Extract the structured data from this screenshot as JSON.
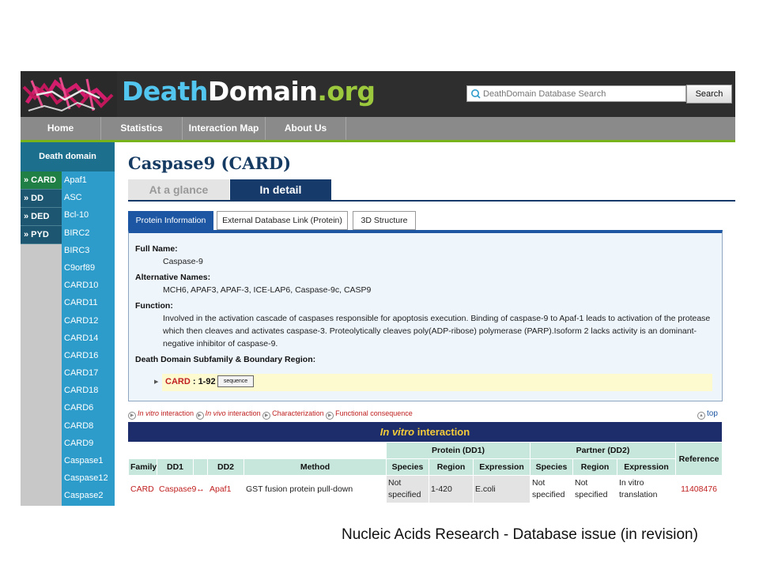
{
  "header": {
    "logo_part1": "Death",
    "logo_part2": "Domain",
    "logo_part3": ".org",
    "search_placeholder": "DeathDomain Database Search",
    "search_button": "Search"
  },
  "nav": {
    "items": [
      "Home",
      "Statistics",
      "Interaction Map",
      "About Us"
    ]
  },
  "sidebar": {
    "heading": "Death domain",
    "categories": [
      "» CARD",
      "» DD",
      "» DED",
      "» PYD"
    ],
    "active_category": "» CARD",
    "proteins": [
      "Apaf1",
      "ASC",
      "Bcl-10",
      "BIRC2",
      "BIRC3",
      "C9orf89",
      "CARD10",
      "CARD11",
      "CARD12",
      "CARD14",
      "CARD16",
      "CARD17",
      "CARD18",
      "CARD6",
      "CARD8",
      "CARD9",
      "Caspase1",
      "Caspase12",
      "Caspase2"
    ]
  },
  "main": {
    "title": "Caspase9 (CARD)",
    "view_tabs": [
      "At a glance",
      "In detail"
    ],
    "active_view_tab": "In detail",
    "sub_tabs": [
      "Protein Information",
      "External Database Link (Protein)",
      "3D Structure"
    ],
    "active_sub_tab": "Protein Information",
    "info": {
      "full_name_label": "Full Name:",
      "full_name": "Caspase-9",
      "alt_names_label": "Alternative Names:",
      "alt_names": "MCH6, APAF3, APAF-3, ICE-LAP6, Caspase-9c, CASP9",
      "function_label": "Function:",
      "function_line1": "Involved in the activation cascade of caspases responsible for apoptosis execution. Binding of caspase-9 to Apaf-1 leads to activation of the protease",
      "function_line2": "which then cleaves and activates caspase-3. Proteolytically cleaves poly(ADP-ribose) polymerase (PARP).Isoform 2 lacks activity is an dominant-",
      "function_line3": "negative inhibitor of caspase-9.",
      "subfamily_label": "Death Domain Subfamily & Boundary Region:",
      "region_name": "CARD",
      "region_sep": " : ",
      "region_range": "1-92",
      "sequence_button": "sequence"
    },
    "section_links": {
      "l1_italic": "In vitro",
      "l1_rest": " interaction",
      "l2_italic": "In vivo",
      "l2_rest": " interaction",
      "l3": "Characterization",
      "l4": "Functional consequence",
      "top": "top"
    },
    "table": {
      "title_italic": "In vitro",
      "title_rest": " interaction",
      "group_headers": {
        "protein": "Protein (DD1)",
        "partner": "Partner (DD2)"
      },
      "columns": [
        "Family",
        "DD1",
        "",
        "DD2",
        "Method",
        "Species",
        "Region",
        "Expression",
        "Species",
        "Region",
        "Expression",
        "Reference"
      ],
      "rows": [
        {
          "family": "CARD",
          "dd1": "Caspase9",
          "arrow": "↔",
          "dd2": "Apaf1",
          "method": "GST fusion protein pull-down",
          "p_species": "Not specified",
          "p_region": "1-420",
          "p_expression": "E.coli",
          "d_species": "Not specified",
          "d_region": "Not specified",
          "d_expression": "In vitro translation",
          "reference": "11408476"
        }
      ]
    }
  },
  "caption": "Nucleic Acids Research - Database issue (in revision)",
  "colors": {
    "header_bg": "#2e2e2e",
    "nav_bg": "#8a8a8a",
    "nav_accent": "#79b31c",
    "sidebar_active": "#1f7f44",
    "sidebar_proteins": "#2d9ccb",
    "title": "#163b63",
    "table_title_bg": "#1d2d6b",
    "table_title_fg": "#f4cc3a",
    "table_header": "#c8e7dc"
  }
}
